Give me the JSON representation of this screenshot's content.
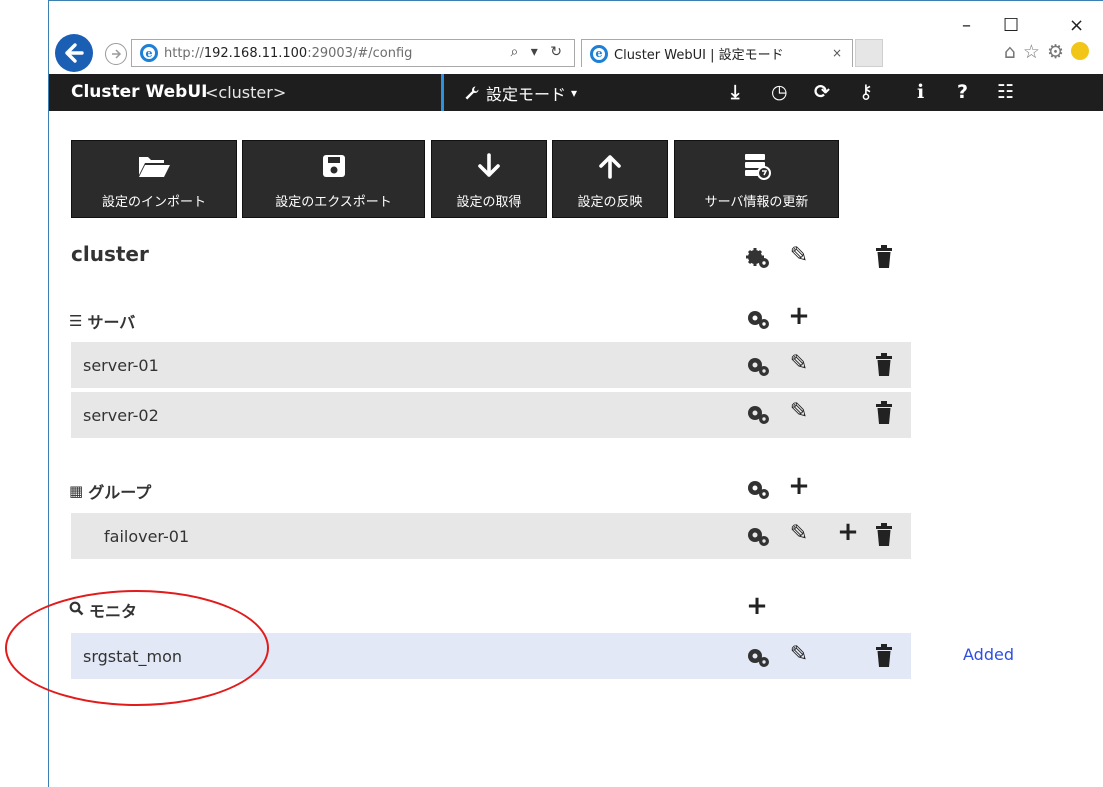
{
  "browser": {
    "window_controls": {
      "minimize": "–",
      "maximize": "☐",
      "close": "×"
    },
    "address": {
      "prefix": "http://",
      "host": "192.168.11.100",
      "rest": ":29003/#/config"
    },
    "address_tools": "⌕ ▾ ↻",
    "tab": {
      "title": "Cluster WebUI | 設定モード",
      "close": "×"
    }
  },
  "app": {
    "brand": "Cluster WebUI",
    "cluster_label": "<cluster>",
    "mode": "設定モード",
    "mode_caret": "▾",
    "nav_icons": [
      "download-icon",
      "clock-icon",
      "refresh-icon",
      "key-icon",
      "info-icon",
      "help-icon",
      "list-icon"
    ],
    "nav_glyphs": {
      "download": "⤓",
      "clock": "◷",
      "refresh": "⟳",
      "key": "⚷",
      "info": "i",
      "help": "?",
      "list": "☷"
    }
  },
  "toolbar": {
    "import": "設定のインポート",
    "export": "設定のエクスポート",
    "get": "設定の取得",
    "apply": "設定の反映",
    "update": "サーバ情報の更新"
  },
  "tree": {
    "cluster_name": "cluster",
    "servers": {
      "heading": "サーバ",
      "items": [
        "server-01",
        "server-02"
      ]
    },
    "groups": {
      "heading": "グループ",
      "items": [
        "failover-01"
      ]
    },
    "monitors": {
      "heading": "モニタ",
      "items": [
        "srgstat_mon"
      ],
      "status": "Added"
    }
  },
  "glyphs": {
    "pencil": "✎",
    "plus": "+",
    "trash": "🗑"
  },
  "colors": {
    "nav_bg": "#1e1e1e",
    "accent": "#2f8fe0",
    "status_added": "#2e4ee0",
    "highlight_circle": "#e21b1b",
    "selected_row": "#e2e8f6"
  }
}
